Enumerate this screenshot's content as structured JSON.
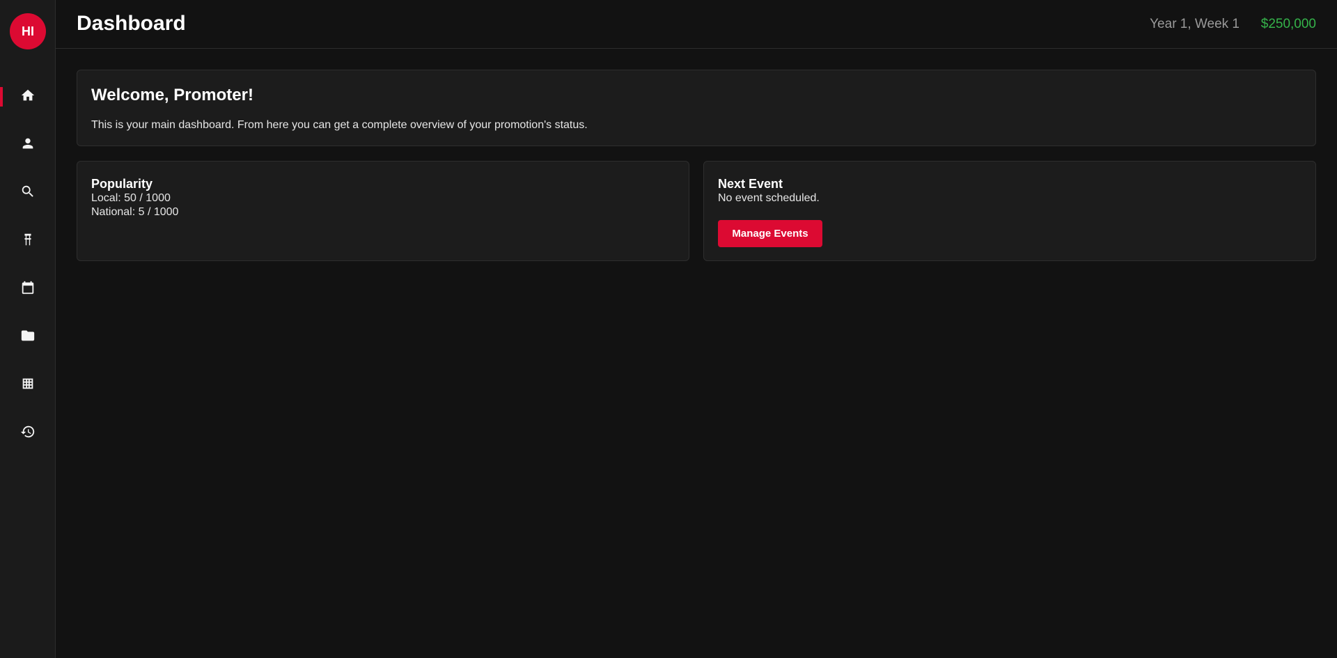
{
  "brand": {
    "logo_text": "HI",
    "accent": "#dc0a32"
  },
  "sidebar": {
    "items": [
      {
        "icon": "home-icon",
        "active": true
      },
      {
        "icon": "person-icon",
        "active": false
      },
      {
        "icon": "search-icon",
        "active": false
      },
      {
        "icon": "ring-icon",
        "active": false
      },
      {
        "icon": "calendar-icon",
        "active": false
      },
      {
        "icon": "folder-icon",
        "active": false
      },
      {
        "icon": "grid-icon",
        "active": false
      },
      {
        "icon": "history-icon",
        "active": false
      }
    ]
  },
  "header": {
    "title": "Dashboard",
    "date": "Year 1, Week 1",
    "money": "$250,000",
    "money_color": "#35b34a"
  },
  "welcome": {
    "title": "Welcome, Promoter!",
    "text": "This is your main dashboard. From here you can get a complete overview of your promotion's status."
  },
  "popularity": {
    "title": "Popularity",
    "local": "Local: 50 / 1000",
    "national": "National: 5 / 1000"
  },
  "next_event": {
    "title": "Next Event",
    "status": "No event scheduled.",
    "button_label": "Manage Events"
  }
}
